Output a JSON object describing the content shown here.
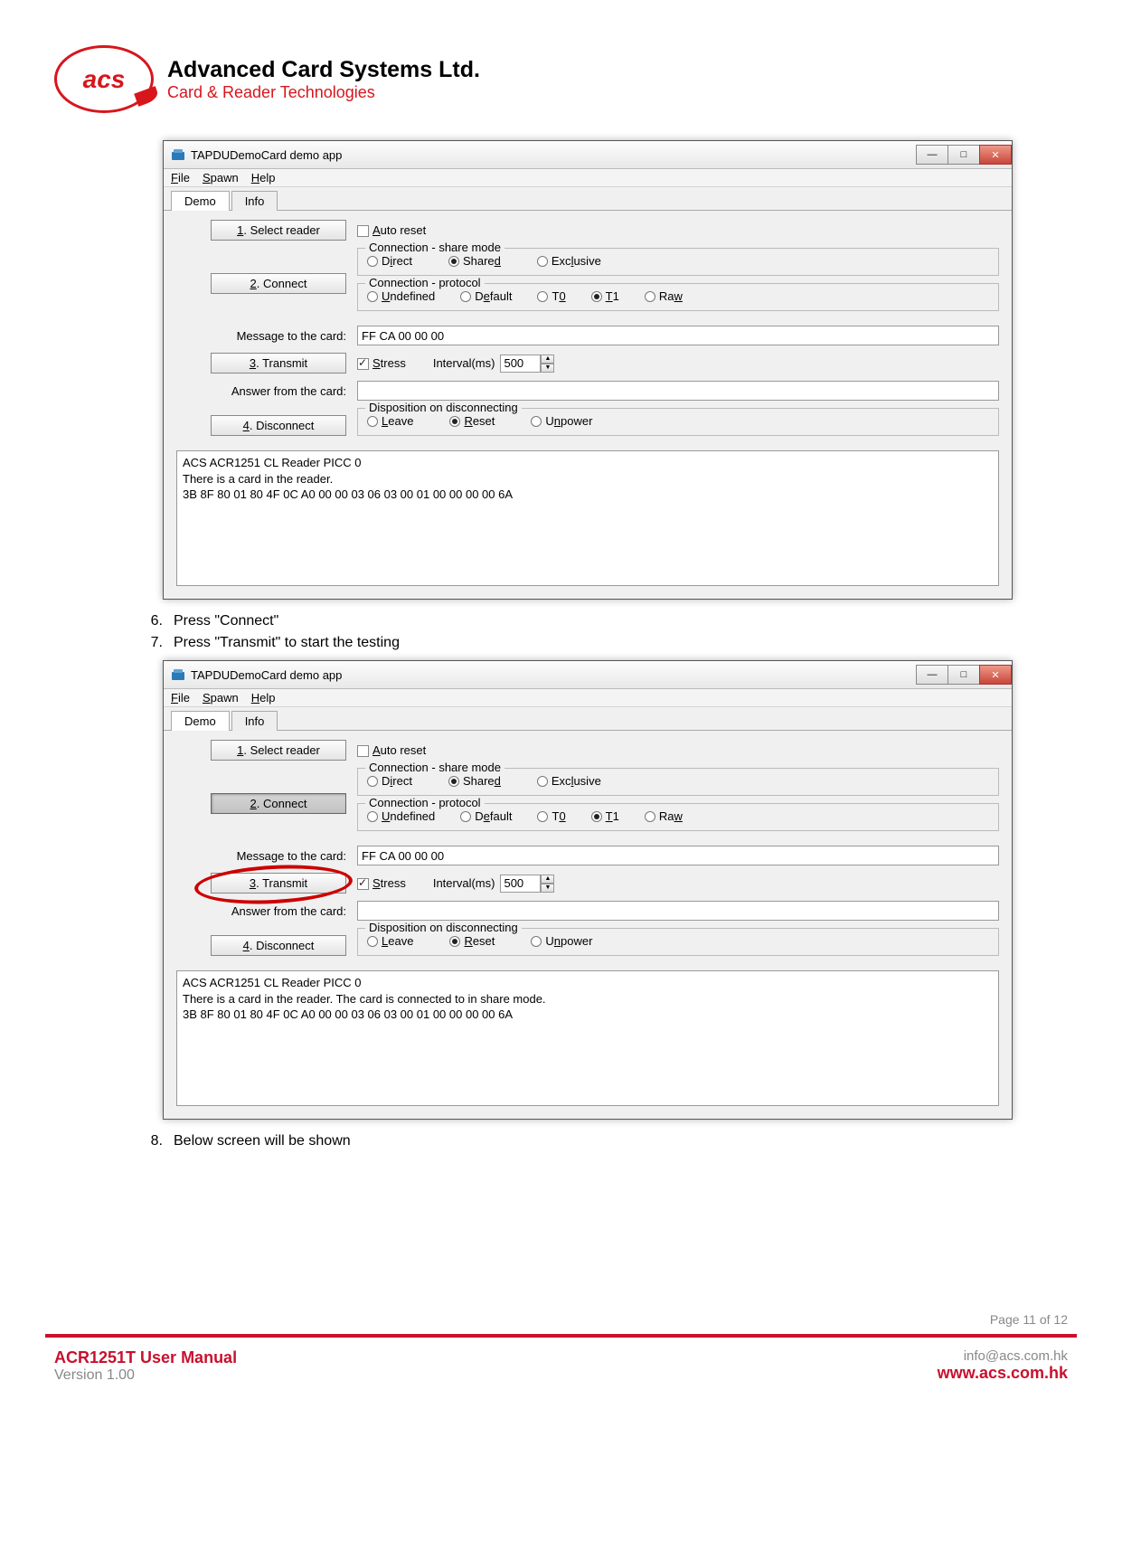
{
  "company": {
    "logo": "acs",
    "name": "Advanced Card Systems Ltd.",
    "tag": "Card & Reader Technologies"
  },
  "steps": {
    "s6_num": "6.",
    "s6": "Press \"Connect\"",
    "s7_num": "7.",
    "s7": "Press \"Transmit\" to start the testing",
    "s8_num": "8.",
    "s8": "Below screen will be shown"
  },
  "win": {
    "title": "TAPDUDemoCard demo app",
    "menu": {
      "file": "File",
      "spawn": "Spawn",
      "help": "Help"
    },
    "tabs": {
      "demo": "Demo",
      "info": "Info"
    },
    "buttons": {
      "select": "1. Select reader",
      "connect": "2. Connect",
      "transmit": "3. Transmit",
      "disconnect": "4. Disconnect"
    },
    "labels": {
      "autoreset": "Auto reset",
      "share": "Connection - share mode",
      "direct": "Direct",
      "shared": "Shared",
      "exclusive": "Exclusive",
      "protocol": "Connection - protocol",
      "undefined": "Undefined",
      "default": "Default",
      "t0": "T0",
      "t1": "T1",
      "raw": "Raw",
      "msg": "Message to the card:",
      "stress": "Stress",
      "interval": "Interval(ms)",
      "interval_val": "500",
      "answer": "Answer from the card:",
      "disp": "Disposition on disconnecting",
      "leave": "Leave",
      "reset": "Reset",
      "unpower": "Unpower"
    },
    "msg_value": "FF CA 00 00 00",
    "log1": "ACS ACR1251 CL Reader PICC 0\nThere is a card in the reader.\n3B 8F 80 01 80 4F 0C A0 00 00 03 06 03 00 01 00 00 00 00 6A",
    "log2": "ACS ACR1251 CL Reader PICC 0\nThere is a card in the reader. The card is connected to in share mode.\n3B 8F 80 01 80 4F 0C A0 00 00 03 06 03 00 01 00 00 00 00 6A"
  },
  "footer": {
    "page": "Page 11 of 12",
    "title": "ACR1251T User Manual",
    "version": "Version 1.00",
    "email": "info@acs.com.hk",
    "site": "www.acs.com.hk"
  }
}
